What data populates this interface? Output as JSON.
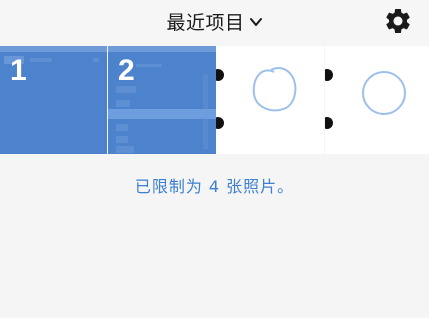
{
  "header": {
    "title": "最近项目",
    "dropdown_icon": "chevron-down-icon",
    "settings_icon": "gear-icon"
  },
  "photos": [
    {
      "selected_index": "1",
      "kind": "screenshot"
    },
    {
      "selected_index": "2",
      "kind": "screenshot"
    },
    {
      "kind": "drawing"
    },
    {
      "kind": "drawing"
    }
  ],
  "notice": {
    "text": "已限制为 4 张照片。"
  },
  "colors": {
    "accent": "#3d7fd0",
    "selection_overlay": "#4d82cc"
  }
}
